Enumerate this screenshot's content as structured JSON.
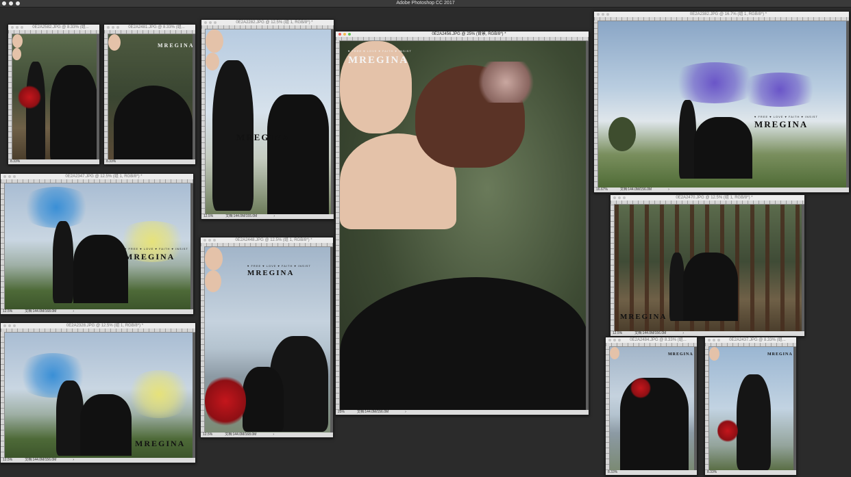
{
  "app": {
    "title": "Adobe Photoshop CC 2017"
  },
  "brand": {
    "name": "MREGINA",
    "tagline": "♥ FREE   ♥ LOVE   ♥ FAITH   ♥ INSIST"
  },
  "documents": [
    {
      "id": "d1",
      "title": "0E2A2582.JPG @ 8.33% (组...",
      "zoom": "8.33%",
      "size": ""
    },
    {
      "id": "d2",
      "title": "0E2A2481.JPG @ 8.33% (组...",
      "zoom": "8.33%",
      "size": ""
    },
    {
      "id": "d3",
      "title": "0E2A2282.JPG @ 12.5% (组 1, RGB/8*) *",
      "zoom": "12.5%",
      "size": "文档:144.0M/155.0M"
    },
    {
      "id": "d4",
      "title": "0E2A2456.JPG @ 25% (背景, RGB/8*) *",
      "zoom": "25%",
      "size": "文档:144.0M/156.0M"
    },
    {
      "id": "d5",
      "title": "0E2A2382.JPG @ 16.7% (组 1, RGB/8*) *",
      "zoom": "16.67%",
      "size": "文档:144.0M/156.0M"
    },
    {
      "id": "d6",
      "title": "0E2A2347.JPG @ 12.5% (组 1, RGB/8*) *",
      "zoom": "12.5%",
      "size": "文档:144.0M/168.0M"
    },
    {
      "id": "d7",
      "title": "0E2A2448.JPG @ 12.5% (组 1, RGB/8*) *",
      "zoom": "12.5%",
      "size": "文档:144.0M/168.0M"
    },
    {
      "id": "d8",
      "title": "0E2A2328.JPG @ 12.5% (组 1, RGB/8*) *",
      "zoom": "12.5%",
      "size": "文档:144.0M/156.0M"
    },
    {
      "id": "d9",
      "title": "0E2A2470.JPG @ 12.5% (组 1, RGB/8*) *",
      "zoom": "12.5%",
      "size": "文档:144.0M/156.0M"
    },
    {
      "id": "d10",
      "title": "0E2A2484.JPG @ 8.33% (组...",
      "zoom": "8.33%",
      "size": ""
    },
    {
      "id": "d11",
      "title": "0E2A2437.JPG @ 8.33% (组...",
      "zoom": "8.33%",
      "size": ""
    }
  ]
}
